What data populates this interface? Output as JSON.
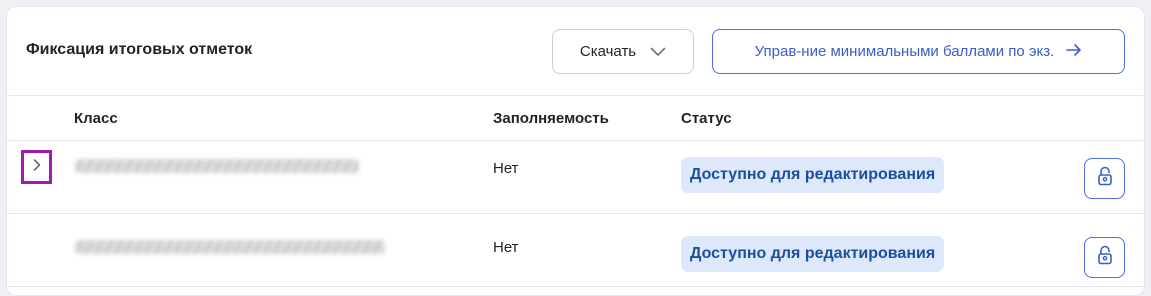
{
  "panel": {
    "title": "Фиксация итоговых отметок",
    "download_label": "Скачать",
    "manage_label": "Управ-ние минимальными баллами по экз."
  },
  "table": {
    "columns": [
      "Класс",
      "Заполняемость",
      "Статус"
    ],
    "rows": [
      {
        "class": "",
        "fill": "Нет",
        "status": "Доступно для редактирования",
        "expanded": false
      },
      {
        "class": "",
        "fill": "Нет",
        "status": "Доступно для редактирования"
      }
    ]
  },
  "colors": {
    "accent": "#3a5fc8",
    "status_bg": "#dde9fb",
    "status_text": "#1d4e9e",
    "focus_outline": "#a21aad"
  },
  "icons": {
    "download": "chevron-down-icon",
    "manage": "arrow-right-icon",
    "expand": "chevron-right-icon",
    "lock": "unlock-icon"
  }
}
